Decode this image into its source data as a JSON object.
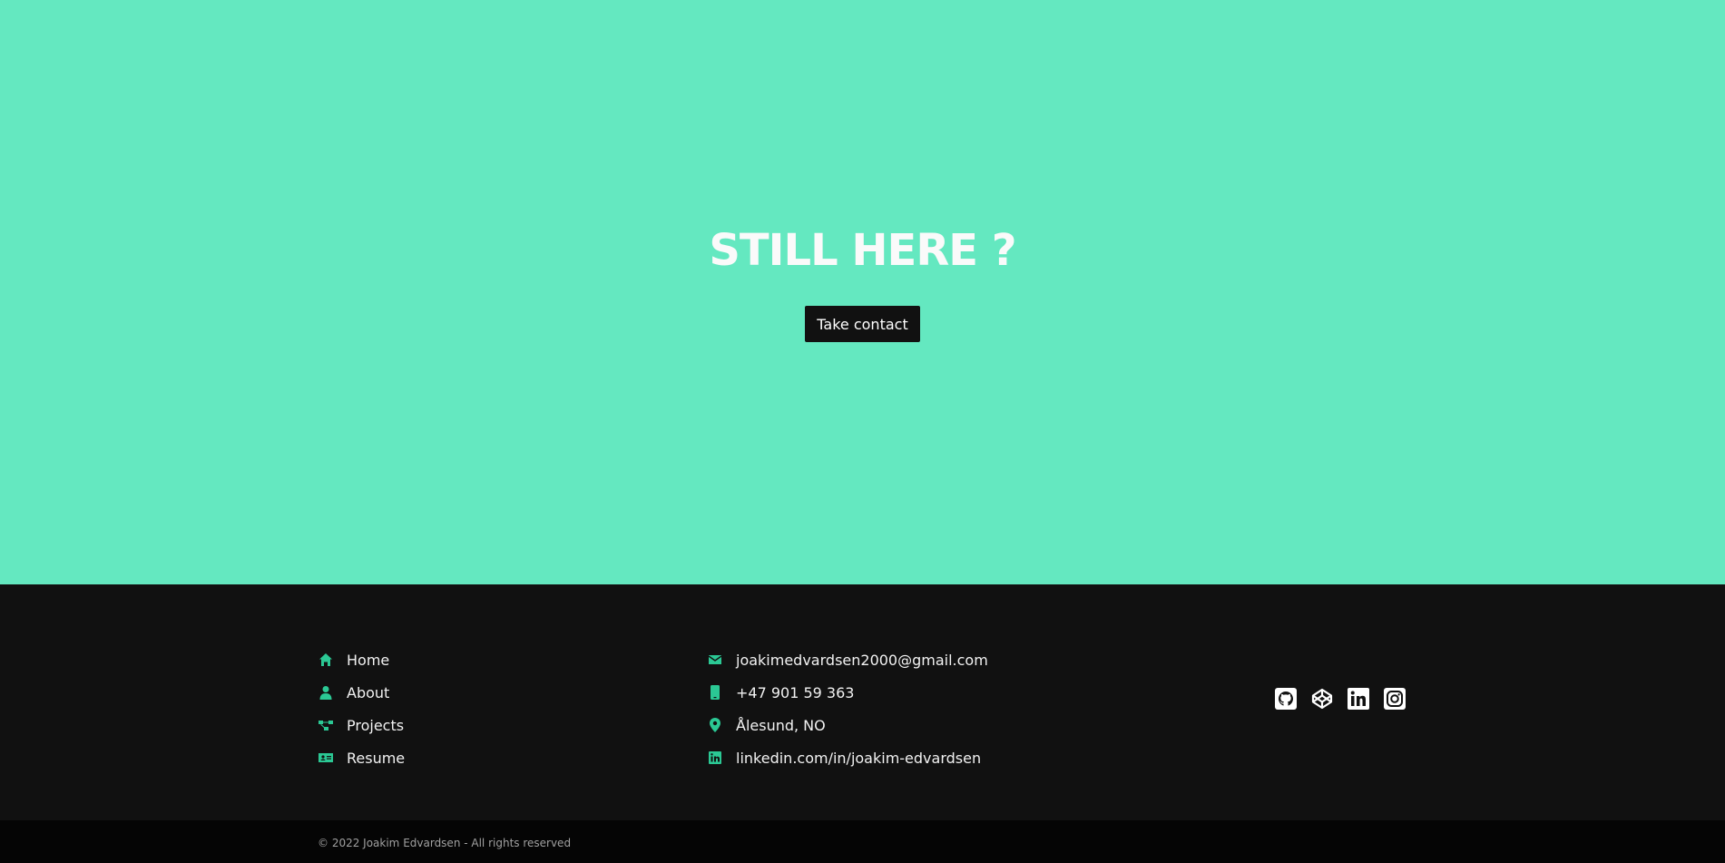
{
  "hero": {
    "title": "STILL HERE ?",
    "cta_label": "Take contact",
    "background": "#64e8c0"
  },
  "footer": {
    "nav": [
      {
        "label": "Home",
        "icon": "home-icon"
      },
      {
        "label": "About",
        "icon": "user-icon"
      },
      {
        "label": "Projects",
        "icon": "project-diagram-icon"
      },
      {
        "label": "Resume",
        "icon": "id-card-icon"
      }
    ],
    "contact": [
      {
        "label": "joakimedvardsen2000@gmail.com",
        "icon": "envelope-icon"
      },
      {
        "label": "+47 901 59 363",
        "icon": "mobile-icon"
      },
      {
        "label": "Ålesund, NO",
        "icon": "map-marker-icon"
      },
      {
        "label": "linkedin.com/in/joakim-edvardsen",
        "icon": "linkedin-icon"
      }
    ],
    "social": [
      "github-icon",
      "codepen-icon",
      "linkedin-icon",
      "instagram-icon"
    ],
    "accent": "#2bc894",
    "copyright": "© 2022 Joakim Edvardsen - All rights reserved"
  }
}
